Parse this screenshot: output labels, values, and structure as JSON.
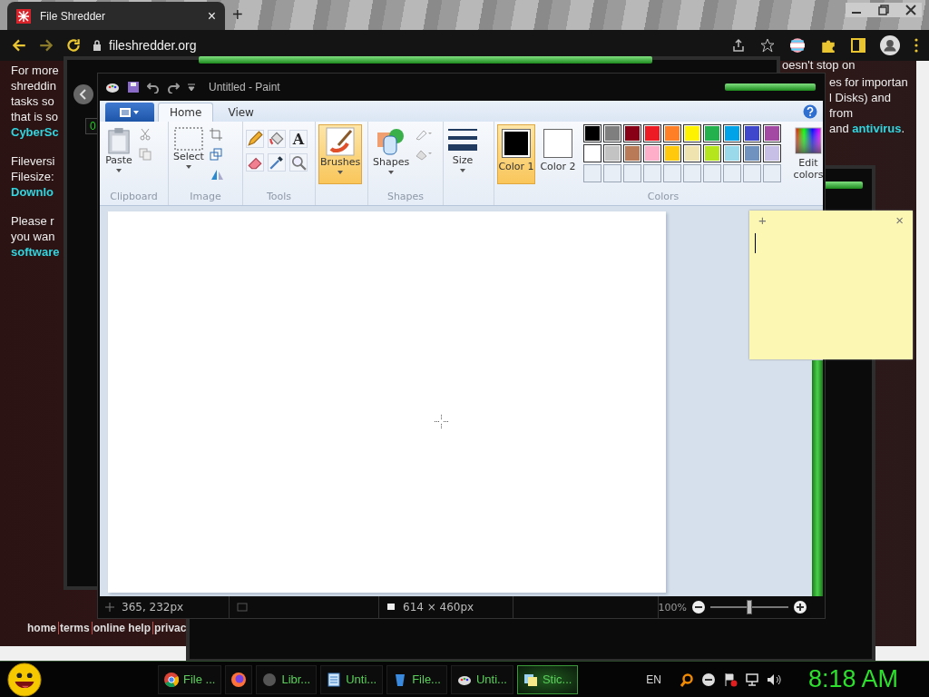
{
  "browser": {
    "tab_title": "File Shredder",
    "tab_close": "×",
    "new_tab": "+",
    "address": "fileshredder.org"
  },
  "page": {
    "left_paragraphs": [
      {
        "lines": [
          {
            "text": "For more",
            "kind": "plain"
          },
          {
            "text": "shreddin",
            "kind": "plain"
          },
          {
            "text": "tasks so",
            "kind": "plain"
          },
          {
            "text": "that is so",
            "kind": "plain"
          },
          {
            "text": "CyberSc",
            "kind": "link"
          }
        ]
      },
      {
        "lines": [
          {
            "text": "Fileversi",
            "kind": "plain"
          },
          {
            "text": "Filesize:",
            "kind": "plain"
          },
          {
            "text": "Downlo",
            "kind": "link"
          }
        ]
      },
      {
        "lines": [
          {
            "text": "Please r",
            "kind": "plain"
          },
          {
            "text": "you wan",
            "kind": "plain"
          },
          {
            "text": "software",
            "kind": "link"
          }
        ]
      }
    ],
    "right_lines": [
      {
        "segments": [
          {
            "text": "oesn't stop on",
            "kind": "plain"
          }
        ]
      },
      {
        "segments": [
          {
            "text": "es for importan",
            "kind": "plain"
          }
        ]
      },
      {
        "segments": [
          {
            "text": "l Disks) and",
            "kind": "plain"
          }
        ]
      },
      {
        "segments": [
          {
            "text": "from",
            "kind": "plain"
          }
        ]
      },
      {
        "segments": [
          {
            "text": "and ",
            "kind": "plain"
          },
          {
            "text": "antivirus",
            "kind": "link"
          },
          {
            "text": ".",
            "kind": "plain"
          }
        ]
      }
    ],
    "footer_links": [
      "home",
      "terms",
      "online help",
      "privac"
    ]
  },
  "player": {
    "counter": "0"
  },
  "paint": {
    "title": "Untitled - Paint",
    "tabs": [
      {
        "label": "Home",
        "selected": true
      },
      {
        "label": "View",
        "selected": false
      }
    ],
    "groups": {
      "clipboard": "Clipboard",
      "image": "Image",
      "tools": "Tools",
      "shapes": "Shapes",
      "colors": "Colors"
    },
    "paste": "Paste",
    "select": "Select",
    "brushes": {
      "label": "Brushes",
      "selected": true
    },
    "shapes_button": "Shapes",
    "size": "Size",
    "tools": [
      {
        "kind": "pencil"
      },
      {
        "kind": "fill"
      },
      {
        "kind": "text",
        "glyph": "A"
      },
      {
        "kind": "eraser"
      },
      {
        "kind": "picker"
      },
      {
        "kind": "magnifier"
      }
    ],
    "color_slots": [
      {
        "label": "Color 1",
        "color": "#000000",
        "selected": true
      },
      {
        "label": "Color 2",
        "color": "#ffffff",
        "selected": false
      }
    ],
    "palette": [
      [
        {
          "color": "#000000"
        },
        {
          "color": "#7f7f7f"
        },
        {
          "color": "#880015"
        },
        {
          "color": "#ed1c24"
        },
        {
          "color": "#ff7f27"
        },
        {
          "color": "#fff200"
        },
        {
          "color": "#22b14c"
        },
        {
          "color": "#00a2e8"
        },
        {
          "color": "#3f48cc"
        },
        {
          "color": "#a349a4"
        }
      ],
      [
        {
          "color": "#ffffff"
        },
        {
          "color": "#c3c3c3"
        },
        {
          "color": "#b97a57"
        },
        {
          "color": "#ffaec9"
        },
        {
          "color": "#ffc90e"
        },
        {
          "color": "#efe4b0"
        },
        {
          "color": "#b5e61d"
        },
        {
          "color": "#99d9ea"
        },
        {
          "color": "#7092be"
        },
        {
          "color": "#c8bfe7"
        }
      ]
    ],
    "edit_colors": "Edit colors",
    "status": {
      "cursor": "365, 232px",
      "canvas_size": "614 × 460px",
      "zoom": "100%"
    },
    "zoom_slider": {
      "level": 0.5
    }
  },
  "sticky": {
    "add": "+",
    "close": "×"
  },
  "taskbar": {
    "items": [
      {
        "kind": "chrome",
        "label": "File ...",
        "selected": false
      },
      {
        "kind": "firefox",
        "selected": false
      },
      {
        "kind": "library",
        "label": "Libr...",
        "selected": false
      },
      {
        "kind": "notepad",
        "label": "Unti...",
        "selected": false
      },
      {
        "kind": "shredder",
        "label": "File...",
        "selected": false
      },
      {
        "kind": "paint",
        "label": "Unti...",
        "selected": false
      },
      {
        "kind": "sticky",
        "label": "Stic...",
        "selected": true
      }
    ],
    "language": "EN",
    "clock": "8:18 AM"
  }
}
